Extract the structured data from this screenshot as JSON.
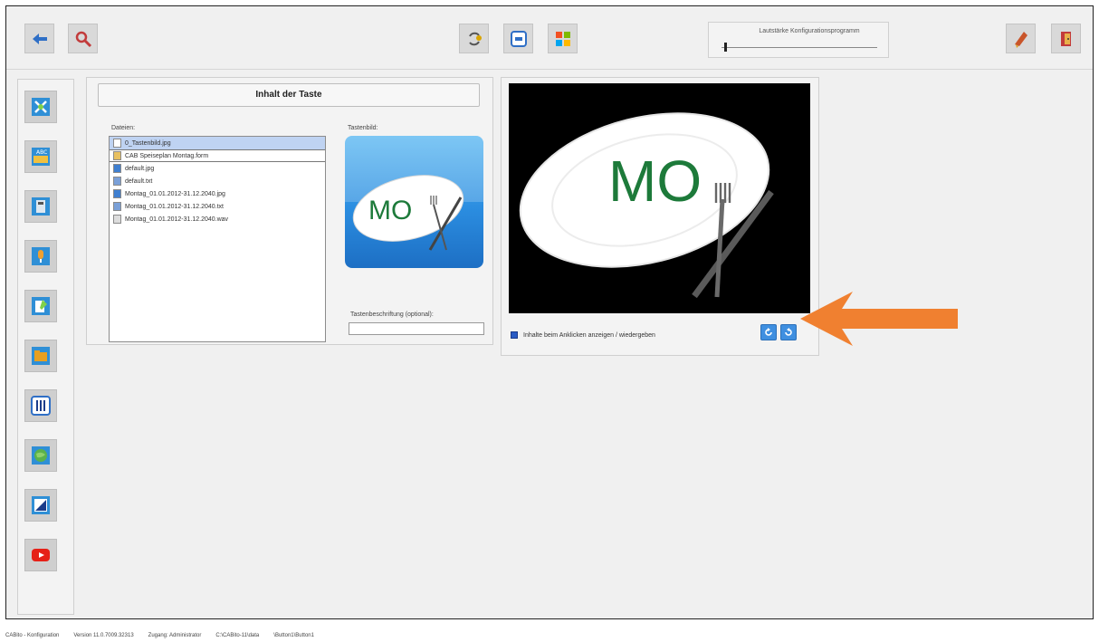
{
  "toolbar": {
    "buttons": [
      {
        "icon": "back-arrow-icon"
      },
      {
        "icon": "search-icon"
      },
      {
        "icon": "recycle-icon"
      },
      {
        "icon": "window-icon"
      },
      {
        "icon": "windows-logo-icon"
      },
      {
        "icon": "cleaning-icon"
      },
      {
        "icon": "exit-door-icon"
      }
    ],
    "volume": {
      "label": "Lautstärke Konfigurationsprogramm",
      "value": 0.02
    }
  },
  "sidebar": {
    "items": [
      {
        "icon": "tools-icon"
      },
      {
        "icon": "keyboard-icon"
      },
      {
        "icon": "calculator-icon"
      },
      {
        "icon": "microphone-icon"
      },
      {
        "icon": "editor-icon"
      },
      {
        "icon": "folder-icon"
      },
      {
        "icon": "mixer-icon"
      },
      {
        "icon": "globe-icon"
      },
      {
        "icon": "ruler-icon"
      },
      {
        "icon": "youtube-icon"
      }
    ]
  },
  "content_panel": {
    "title": "Inhalt der Taste",
    "files_label": "Dateien:",
    "files": [
      {
        "name": "0_Tastenbild.jpg",
        "icon": "file-icon",
        "selected": true
      },
      {
        "name": "CAB Speiseplan Montag.form",
        "icon": "form-icon",
        "selected": false
      },
      {
        "name": "default.jpg",
        "icon": "image-file-icon",
        "selected": false
      },
      {
        "name": "default.txt",
        "icon": "text-file-icon",
        "selected": false
      },
      {
        "name": "Montag_01.01.2012-31.12.2040.jpg",
        "icon": "image-file-icon",
        "selected": false
      },
      {
        "name": "Montag_01.01.2012-31.12.2040.txt",
        "icon": "text-file-icon",
        "selected": false
      },
      {
        "name": "Montag_01.01.2012-31.12.2040.wav",
        "icon": "audio-file-icon",
        "selected": false
      }
    ],
    "image_label": "Tastenbild:",
    "key_image_text": "MO",
    "caption_label": "Tastenbeschriftung (optional):",
    "caption_value": ""
  },
  "preview_panel": {
    "image_text": "MO",
    "checkbox_label": "Inhalte beim Anklicken anzeigen / wiedergeben",
    "checkbox_checked": true
  },
  "status_bar": {
    "items": [
      "CABito - Konfiguration",
      "Version 11.0.7009.32313",
      "Zugang: Administrator",
      "C:\\CABito-11\\data",
      "\\Button1\\Button1"
    ]
  },
  "colors": {
    "accent": "#2a5cc4",
    "arrow": "#f08030",
    "mo_green": "#1d7a3a"
  }
}
